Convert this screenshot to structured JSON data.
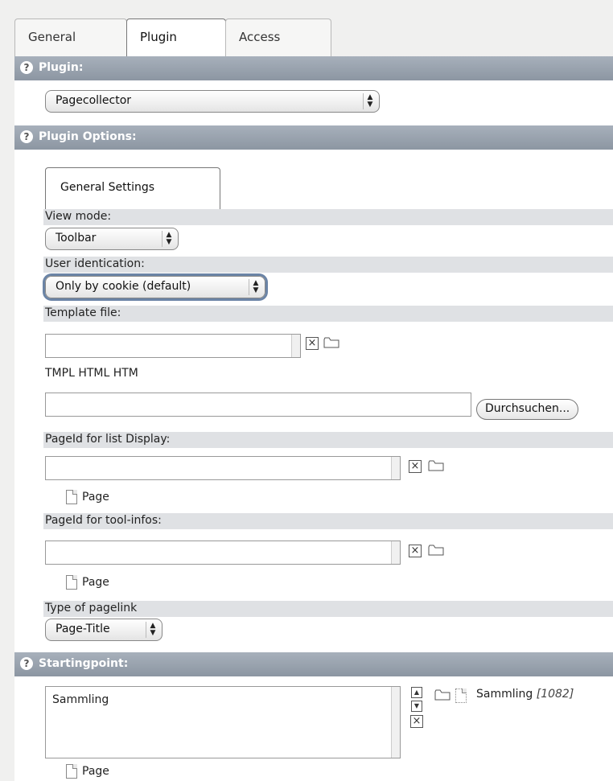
{
  "tabs": [
    "General",
    "Plugin",
    "Access"
  ],
  "sections": {
    "plugin": "Plugin:",
    "plugin_options": "Plugin Options:",
    "startingpoint": "Startingpoint:"
  },
  "plugin_select": "Pagecollector",
  "inner_tab": "General Settings",
  "view_mode": {
    "label": "View mode:",
    "value": "Toolbar"
  },
  "user_ident": {
    "label": "User identication:",
    "value": "Only by cookie (default)"
  },
  "template": {
    "label": "Template file:",
    "types": "TMPL HTML HTM",
    "browse": "Durchsuchen..."
  },
  "pageid_list": {
    "label": "PageId for list Display:",
    "page": "Page"
  },
  "pageid_tool": {
    "label": "PageId for tool-infos:",
    "page": "Page"
  },
  "pagelink": {
    "label": "Type of pagelink",
    "value": "Page-Title"
  },
  "starting": {
    "item": "Sammling",
    "selected_name": "Sammling",
    "selected_id": "[1082]",
    "page": "Page"
  },
  "help_symbol": "?"
}
